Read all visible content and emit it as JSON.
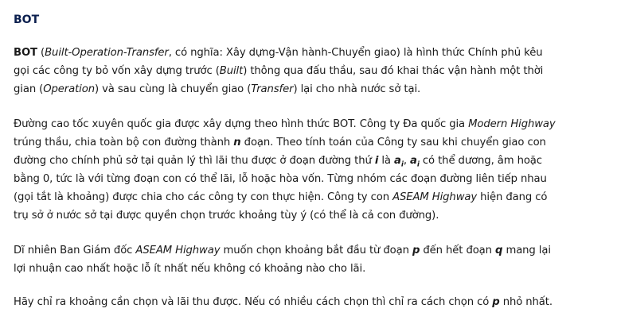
{
  "title": "BOT",
  "p1": {
    "bot": "BOT",
    "t1": " (",
    "built_op": "Built-Operation-Transfer",
    "t2": ", có nghĩa: Xây dựng-Vận hành-Chuyển giao) là hình thức Chính phủ kêu",
    "t3": "gọi các công ty bỏ vốn xây dựng trước (",
    "built": "Built",
    "t4": ") thông qua đấu thầu, sau đó khai thác vận hành một thời",
    "t5": "gian (",
    "operation": "Operation",
    "t6": ") và sau cùng là chuyển giao (",
    "transfer": "Transfer",
    "t7": ") lại cho nhà nước sở tại."
  },
  "p2": {
    "t1": "Đường cao tốc xuyên quốc gia được xây dựng theo hình thức BOT. Công ty Đa quốc gia ",
    "modern": "Modern Highway",
    "t2": "trúng thầu, chia toàn bộ con đường thành ",
    "n": "n",
    "t3": " đoạn. Theo tính toán của Công ty sau khi chuyển giao con",
    "t4": "đường cho chính phủ sở tại quản lý thì lãi thu được ở đoạn đường thứ ",
    "i": "i",
    "t5": " là ",
    "a": "a",
    "sub_i": "i",
    "t6": ", ",
    "a2": "a",
    "sub_i2": "i",
    "t7": " có thể dương, âm hoặc",
    "t8": "bằng 0, tức là với từng đoạn con có thể lãi, lỗ hoặc hòa vốn. Từng nhóm các đoạn đường liên tiếp nhau",
    "t9": "(gọi tắt là khoảng) được chia cho các công ty con thực hiện. Công ty con ",
    "aseam": "ASEAM Highway",
    "t10": " hiện đang có",
    "t11": "trụ sở ở nước sở tại được quyền chọn trước khoảng tùy ý (có thể là cả con đường)."
  },
  "p3": {
    "t1": "Dĩ nhiên Ban Giám đốc ",
    "aseam": "ASEAM Highway",
    "t2": " muốn chọn khoảng bắt đầu từ đoạn ",
    "p": "p",
    "t3": " đến hết đoạn ",
    "q": "q",
    "t4": " mang lại",
    "t5": "lợi nhuận cao nhất hoặc lỗ ít nhất nếu không có khoảng nào cho lãi."
  },
  "p4": {
    "t1": "Hãy chỉ ra khoảng cần chọn và lãi thu được. Nếu có nhiều cách chọn thì chỉ ra cách chọn có ",
    "p": "p",
    "t2": " nhỏ nhất."
  }
}
